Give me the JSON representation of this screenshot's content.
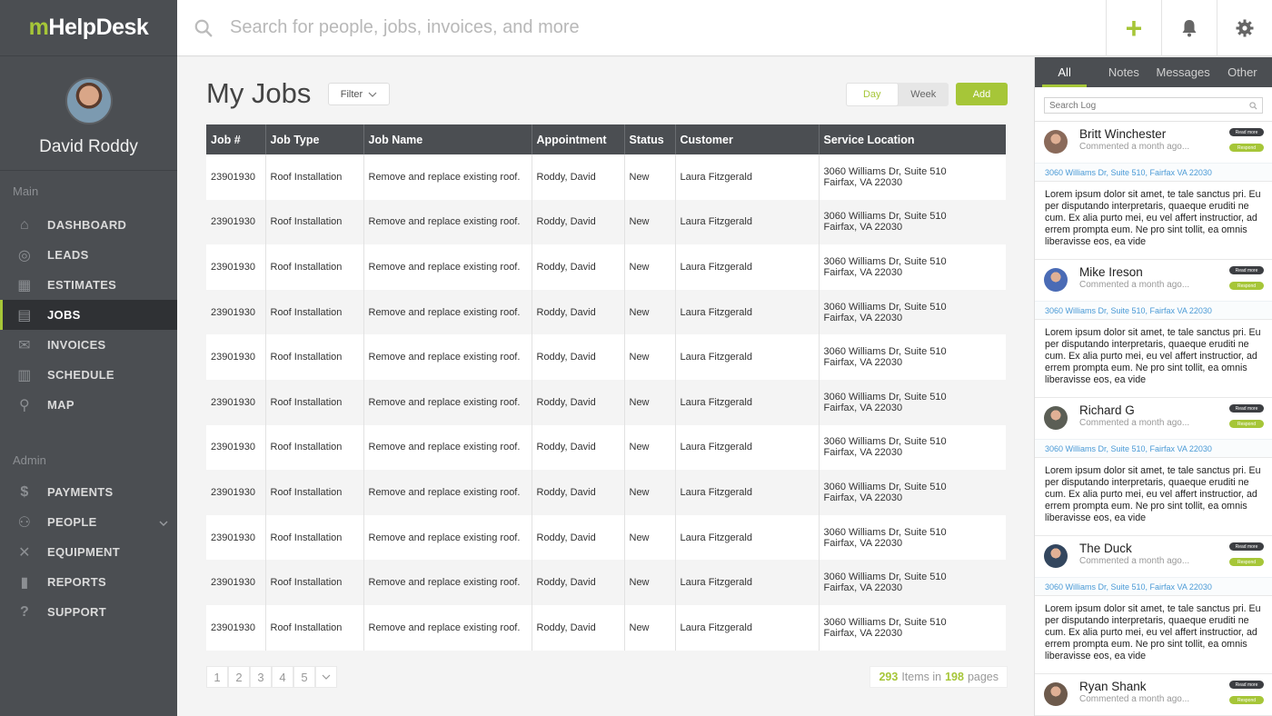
{
  "app": {
    "logo_m": "m",
    "logo_rest": "HelpDesk"
  },
  "user": {
    "name": "David Roddy"
  },
  "sidebar": {
    "main_label": "Main",
    "admin_label": "Admin",
    "main_items": [
      {
        "label": "DASHBOARD",
        "icon": "home-icon",
        "glyph": "⌂"
      },
      {
        "label": "LEADS",
        "icon": "user-lock-icon",
        "glyph": "◎"
      },
      {
        "label": "ESTIMATES",
        "icon": "grid-icon",
        "glyph": "▦"
      },
      {
        "label": "JOBS",
        "icon": "clipboard-icon",
        "glyph": "▤"
      },
      {
        "label": "INVOICES",
        "icon": "envelope-icon",
        "glyph": "✉"
      },
      {
        "label": "SCHEDULE",
        "icon": "calendar-icon",
        "glyph": "▥"
      },
      {
        "label": "MAP",
        "icon": "map-pin-icon",
        "glyph": "⚲"
      }
    ],
    "admin_items": [
      {
        "label": "PAYMENTS",
        "icon": "dollar-icon",
        "glyph": "$"
      },
      {
        "label": "PEOPLE",
        "icon": "people-icon",
        "glyph": "⚇"
      },
      {
        "label": "EQUIPMENT",
        "icon": "tools-icon",
        "glyph": "✕"
      },
      {
        "label": "REPORTS",
        "icon": "bar-chart-icon",
        "glyph": "▮"
      },
      {
        "label": "SUPPORT",
        "icon": "help-icon",
        "glyph": "?"
      }
    ],
    "active": "JOBS"
  },
  "topbar": {
    "search_placeholder": "Search for people, jobs, invoices, and more",
    "add_glyph": "+"
  },
  "main": {
    "title": "My Jobs",
    "filter_label": "Filter",
    "view_day": "Day",
    "view_week": "Week",
    "add_label": "Add",
    "columns": [
      "Job #",
      "Job Type",
      "Job Name",
      "Appointment",
      "Status",
      "Customer",
      "Service Location"
    ],
    "rows": [
      {
        "job": "23901930",
        "type": "Roof Installation",
        "name": "Remove and replace existing roof.",
        "appt": "Roddy, David",
        "status": "New",
        "customer": "Laura Fitzgerald",
        "loc1": "3060 Williams Dr, Suite 510",
        "loc2": "Fairfax, VA 22030"
      },
      {
        "job": "23901930",
        "type": "Roof Installation",
        "name": "Remove and replace existing roof.",
        "appt": "Roddy, David",
        "status": "New",
        "customer": "Laura Fitzgerald",
        "loc1": "3060 Williams Dr, Suite 510",
        "loc2": "Fairfax, VA 22030"
      },
      {
        "job": "23901930",
        "type": "Roof Installation",
        "name": "Remove and replace existing roof.",
        "appt": "Roddy, David",
        "status": "New",
        "customer": "Laura Fitzgerald",
        "loc1": "3060 Williams Dr, Suite 510",
        "loc2": "Fairfax, VA 22030"
      },
      {
        "job": "23901930",
        "type": "Roof Installation",
        "name": "Remove and replace existing roof.",
        "appt": "Roddy, David",
        "status": "New",
        "customer": "Laura Fitzgerald",
        "loc1": "3060 Williams Dr, Suite 510",
        "loc2": "Fairfax, VA 22030"
      },
      {
        "job": "23901930",
        "type": "Roof Installation",
        "name": "Remove and replace existing roof.",
        "appt": "Roddy, David",
        "status": "New",
        "customer": "Laura Fitzgerald",
        "loc1": "3060 Williams Dr, Suite 510",
        "loc2": "Fairfax, VA 22030"
      },
      {
        "job": "23901930",
        "type": "Roof Installation",
        "name": "Remove and replace existing roof.",
        "appt": "Roddy, David",
        "status": "New",
        "customer": "Laura Fitzgerald",
        "loc1": "3060 Williams Dr, Suite 510",
        "loc2": "Fairfax, VA 22030"
      },
      {
        "job": "23901930",
        "type": "Roof Installation",
        "name": "Remove and replace existing roof.",
        "appt": "Roddy, David",
        "status": "New",
        "customer": "Laura Fitzgerald",
        "loc1": "3060 Williams Dr, Suite 510",
        "loc2": "Fairfax, VA 22030"
      },
      {
        "job": "23901930",
        "type": "Roof Installation",
        "name": "Remove and replace existing roof.",
        "appt": "Roddy, David",
        "status": "New",
        "customer": "Laura Fitzgerald",
        "loc1": "3060 Williams Dr, Suite 510",
        "loc2": "Fairfax, VA 22030"
      },
      {
        "job": "23901930",
        "type": "Roof Installation",
        "name": "Remove and replace existing roof.",
        "appt": "Roddy, David",
        "status": "New",
        "customer": "Laura Fitzgerald",
        "loc1": "3060 Williams Dr, Suite 510",
        "loc2": "Fairfax, VA 22030"
      },
      {
        "job": "23901930",
        "type": "Roof Installation",
        "name": "Remove and replace existing roof.",
        "appt": "Roddy, David",
        "status": "New",
        "customer": "Laura Fitzgerald",
        "loc1": "3060 Williams Dr, Suite 510",
        "loc2": "Fairfax, VA 22030"
      },
      {
        "job": "23901930",
        "type": "Roof Installation",
        "name": "Remove and replace existing roof.",
        "appt": "Roddy, David",
        "status": "New",
        "customer": "Laura Fitzgerald",
        "loc1": "3060 Williams Dr, Suite 510",
        "loc2": "Fairfax, VA 22030"
      }
    ],
    "pages": [
      "1",
      "2",
      "3",
      "4",
      "5"
    ],
    "items_count": "293",
    "items_mid": "Items in",
    "pages_count": "198",
    "pages_word": "pages"
  },
  "rpanel": {
    "tabs": [
      "All",
      "Notes",
      "Messages",
      "Other"
    ],
    "search_placeholder": "Search Log",
    "read_more": "Read more",
    "respond": "Respond",
    "entries": [
      {
        "name": "Britt Winchester",
        "meta": "Commented a month ago...",
        "addr": "3060 Williams Dr, Suite 510, Fairfax VA 22030",
        "body": "Lorem ipsum dolor sit amet, te tale sanctus pri. Eu per disputando interpretaris, quaeque eruditi ne cum. Ex alia purto mei, eu vel affert instructior, ad errem prompta eum. Ne pro sint tollit, ea omnis liberavisse eos, ea vide",
        "avatar": "#8a6a5a"
      },
      {
        "name": "Mike Ireson",
        "meta": "Commented a month ago...",
        "addr": "3060 Williams Dr, Suite 510, Fairfax VA 22030",
        "body": "Lorem ipsum dolor sit amet, te tale sanctus pri. Eu per disputando interpretaris, quaeque eruditi ne cum. Ex alia purto mei, eu vel affert instructior, ad errem prompta eum. Ne pro sint tollit, ea omnis liberavisse eos, ea vide",
        "avatar": "#4a6bb5"
      },
      {
        "name": "Richard G",
        "meta": "Commented a month ago...",
        "addr": "3060 Williams Dr, Suite 510, Fairfax VA 22030",
        "body": "Lorem ipsum dolor sit amet, te tale sanctus pri. Eu per disputando interpretaris, quaeque eruditi ne cum. Ex alia purto mei, eu vel affert instructior, ad errem prompta eum. Ne pro sint tollit, ea omnis liberavisse eos, ea vide",
        "avatar": "#5b5e55"
      },
      {
        "name": "The Duck",
        "meta": "Commented a month ago...",
        "addr": "3060 Williams Dr, Suite 510, Fairfax VA 22030",
        "body": "Lorem ipsum dolor sit amet, te tale sanctus pri. Eu per disputando interpretaris, quaeque eruditi ne cum. Ex alia purto mei, eu vel affert instructior, ad errem prompta eum. Ne pro sint tollit, ea omnis liberavisse eos, ea vide",
        "avatar": "#33465e"
      },
      {
        "name": "Ryan Shank",
        "meta": "Commented a month ago...",
        "addr": "",
        "body": "",
        "avatar": "#6d5a4c"
      }
    ]
  },
  "colors": {
    "accent": "#a6c638",
    "sidebar": "#4b4e52",
    "link": "#4a9ad6"
  }
}
